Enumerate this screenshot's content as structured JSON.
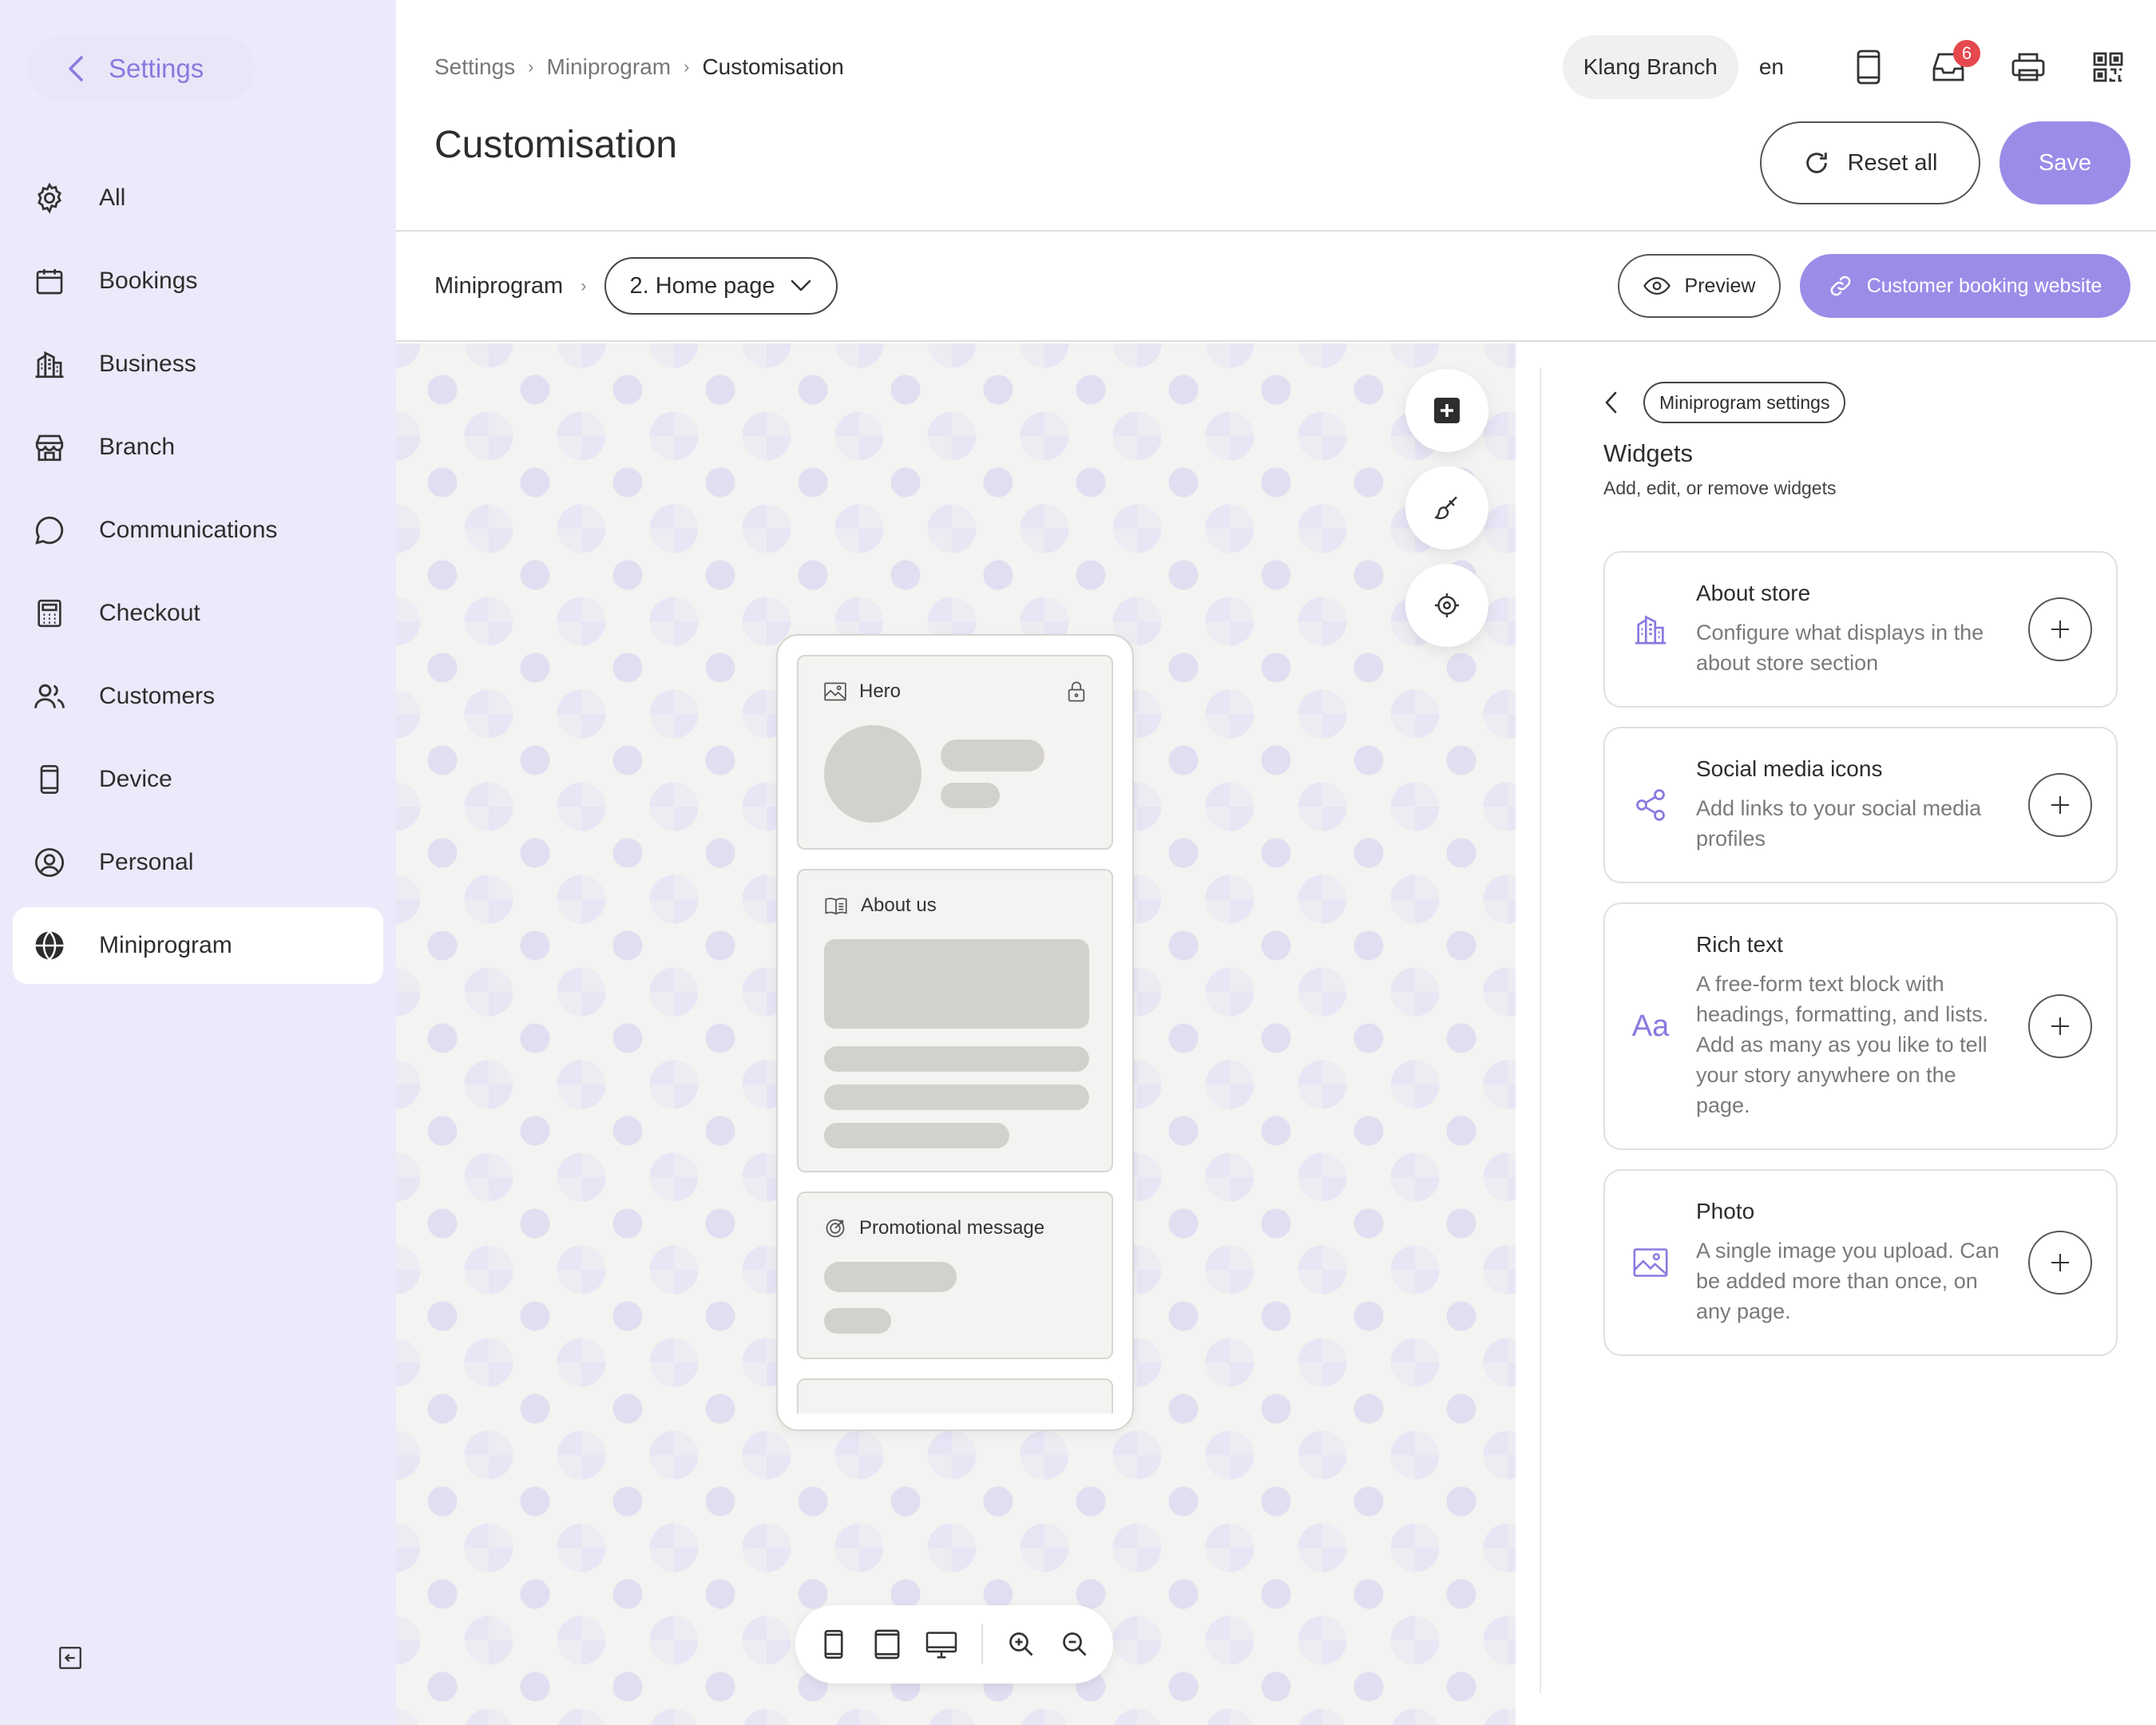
{
  "sidebar": {
    "title": "Settings",
    "items": [
      {
        "label": "All",
        "icon": "gear-icon"
      },
      {
        "label": "Bookings",
        "icon": "calendar-icon"
      },
      {
        "label": "Business",
        "icon": "building-icon"
      },
      {
        "label": "Branch",
        "icon": "store-icon"
      },
      {
        "label": "Communications",
        "icon": "chat-bubble-icon"
      },
      {
        "label": "Checkout",
        "icon": "calculator-icon"
      },
      {
        "label": "Customers",
        "icon": "users-icon"
      },
      {
        "label": "Device",
        "icon": "phone-icon"
      },
      {
        "label": "Personal",
        "icon": "user-circle-icon"
      },
      {
        "label": "Miniprogram",
        "icon": "globe-icon",
        "active": true
      }
    ]
  },
  "header": {
    "breadcrumb": [
      "Settings",
      "Miniprogram",
      "Customisation"
    ],
    "title": "Customisation",
    "branch": "Klang Branch",
    "language": "en",
    "inbox_badge": "6",
    "reset_label": "Reset all",
    "save_label": "Save"
  },
  "toolbar": {
    "section_label": "Miniprogram",
    "page_select": "2. Home page",
    "preview_label": "Preview",
    "booking_label": "Customer booking website"
  },
  "preview": {
    "widgets": [
      {
        "label": "Hero"
      },
      {
        "label": "About us"
      },
      {
        "label": "Promotional message"
      }
    ]
  },
  "panel": {
    "back_chip": "Miniprogram settings",
    "title": "Widgets",
    "subtitle": "Add, edit, or remove widgets",
    "widgets": [
      {
        "name": "About store",
        "desc": "Configure what displays in the about store section",
        "icon": "building-icon"
      },
      {
        "name": "Social media icons",
        "desc": "Add links to your social media profiles",
        "icon": "share-icon"
      },
      {
        "name": "Rich text",
        "desc": "A free-form text block with headings, formatting, and lists. Add as many as you like to tell your story anywhere on the page.",
        "icon": "text-aa-icon",
        "glyph": "Aa"
      },
      {
        "name": "Photo",
        "desc": "A single image you upload. Can be added more than once, on any page.",
        "icon": "image-icon"
      }
    ]
  },
  "colors": {
    "accent": "#9b8ce8",
    "sidebar_bg": "#eceafa",
    "badge": "#e5484d"
  }
}
